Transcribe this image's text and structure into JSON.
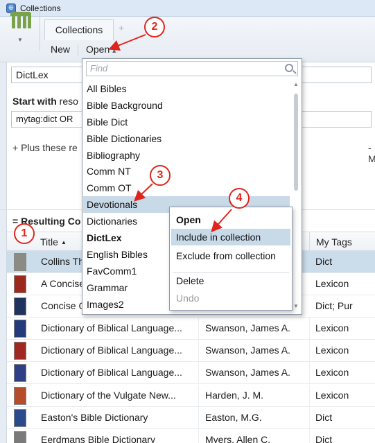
{
  "window": {
    "title": "Collections"
  },
  "tabs": {
    "active": "Collections",
    "add": "+"
  },
  "toolbar": {
    "new_label": "New",
    "open_label": "Open"
  },
  "collection_name": "DictLex",
  "start_with": {
    "bold": "Start with",
    "rest": " reso"
  },
  "query": "mytag:dict OR",
  "plus_these": "+  Plus these re",
  "minus_right": "-",
  "minus_right_letter": "M",
  "resulting": "Resulting Co",
  "table": {
    "headers": {
      "title": "Title",
      "tags": "My Tags"
    },
    "rows": [
      {
        "title": "Collins Th",
        "author": "",
        "tags": "Dict",
        "cover": "#8b8b83"
      },
      {
        "title": "A Concise",
        "author": "",
        "tags": "Lexicon",
        "cover": "#9c2a1c"
      },
      {
        "title": "Concise G",
        "author": "",
        "tags": "Dict; Pur",
        "cover": "#20325e"
      },
      {
        "title": "Dictionary of Biblical Language...",
        "author": "Swanson, James A.",
        "tags": "Lexicon",
        "cover": "#243a7a"
      },
      {
        "title": "Dictionary of Biblical Language...",
        "author": "Swanson, James A.",
        "tags": "Lexicon",
        "cover": "#a02822"
      },
      {
        "title": "Dictionary of Biblical Language...",
        "author": "Swanson, James A.",
        "tags": "Lexicon",
        "cover": "#2e3f86"
      },
      {
        "title": "Dictionary of the Vulgate New...",
        "author": "Harden, J. M.",
        "tags": "Lexicon",
        "cover": "#b64c2a"
      },
      {
        "title": "Easton's Bible Dictionary",
        "author": "Easton, M.G.",
        "tags": "Dict",
        "cover": "#2b4a8c"
      },
      {
        "title": "Eerdmans Bible Dictionary",
        "author": "Myers, Allen C.",
        "tags": "Dict",
        "cover": "#7a7a7a"
      }
    ]
  },
  "open_dropdown": {
    "find_placeholder": "Find",
    "items": [
      "All Bibles",
      "Bible Background",
      "Bible Dict",
      "Bible Dictionaries",
      "Bibliography",
      "Comm NT",
      "Comm OT",
      "Devotionals",
      "Dictionaries",
      "DictLex",
      "English Bibles",
      "FavComm1",
      "Grammar",
      "Images2"
    ]
  },
  "context_menu": {
    "open": "Open",
    "include": "Include in collection",
    "exclude": "Exclude from collection",
    "delete": "Delete",
    "undo": "Undo"
  },
  "callouts": [
    "1",
    "2",
    "3",
    "4"
  ],
  "colors": {
    "callout": "#e0241b",
    "selection": "#cbdcea",
    "hover": "#c8d9e8"
  }
}
